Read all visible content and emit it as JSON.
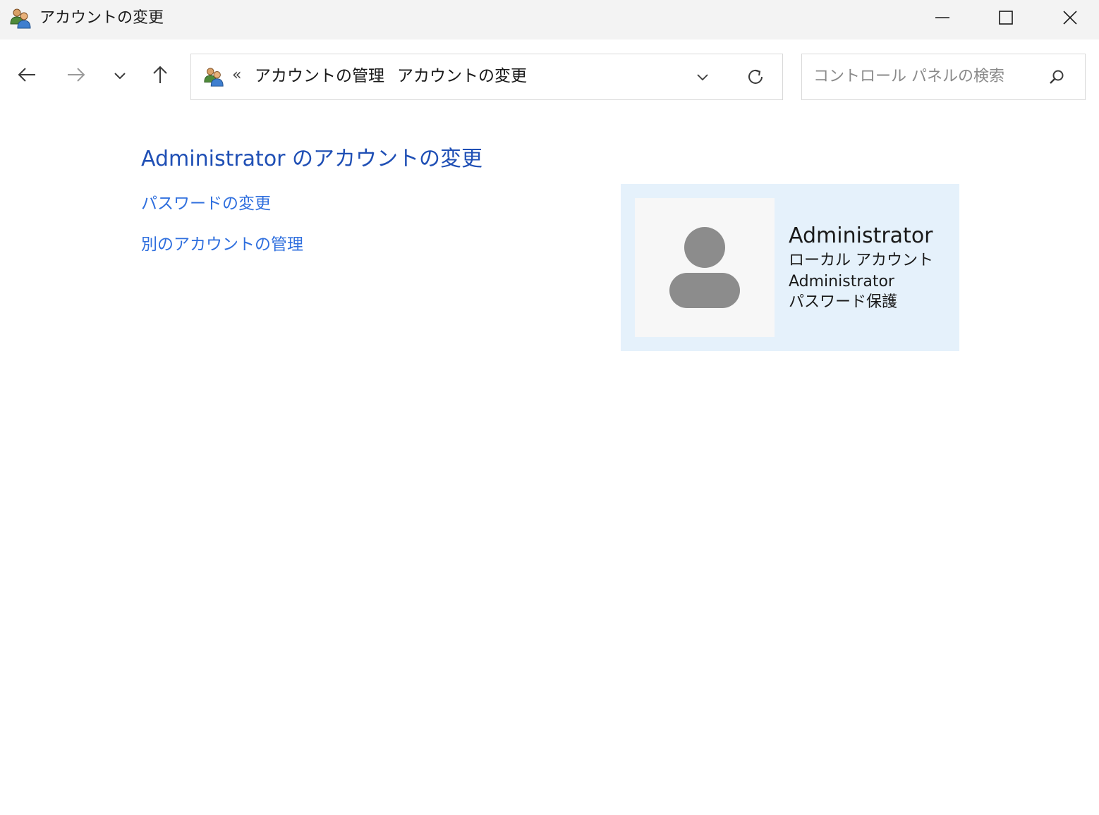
{
  "window": {
    "title": "アカウントの変更",
    "icon": "users-icon",
    "controls": {
      "minimize_icon": "minimize-icon",
      "maximize_icon": "maximize-icon",
      "close_icon": "close-icon"
    }
  },
  "navigation": {
    "back_icon": "arrow-left-icon",
    "forward_icon": "arrow-right-icon",
    "recent_icon": "chevron-down-icon",
    "up_icon": "arrow-up-icon"
  },
  "address_bar": {
    "icon": "users-icon",
    "overflow_chevron": "«",
    "breadcrumb": [
      "アカウントの管理",
      "アカウントの変更"
    ],
    "separator": "›",
    "dropdown_icon": "chevron-down-icon",
    "refresh_icon": "refresh-icon"
  },
  "search": {
    "placeholder": "コントロール パネルの検索",
    "icon": "search-icon"
  },
  "main": {
    "title": "Administrator のアカウントの変更",
    "links": [
      {
        "label": "パスワードの変更"
      },
      {
        "label": "別のアカウントの管理"
      }
    ]
  },
  "account_card": {
    "name": "Administrator",
    "type": "ローカル アカウント",
    "group": "Administrator",
    "password_status": "パスワード保護"
  },
  "colors": {
    "titlebar_bg": "#f3f3f3",
    "title_link": "#1f4fb5",
    "link": "#2f6fde",
    "card_bg": "#e5f1fb",
    "avatar_bg": "#f7f7f7",
    "avatar_figure": "#8c8c8c"
  }
}
